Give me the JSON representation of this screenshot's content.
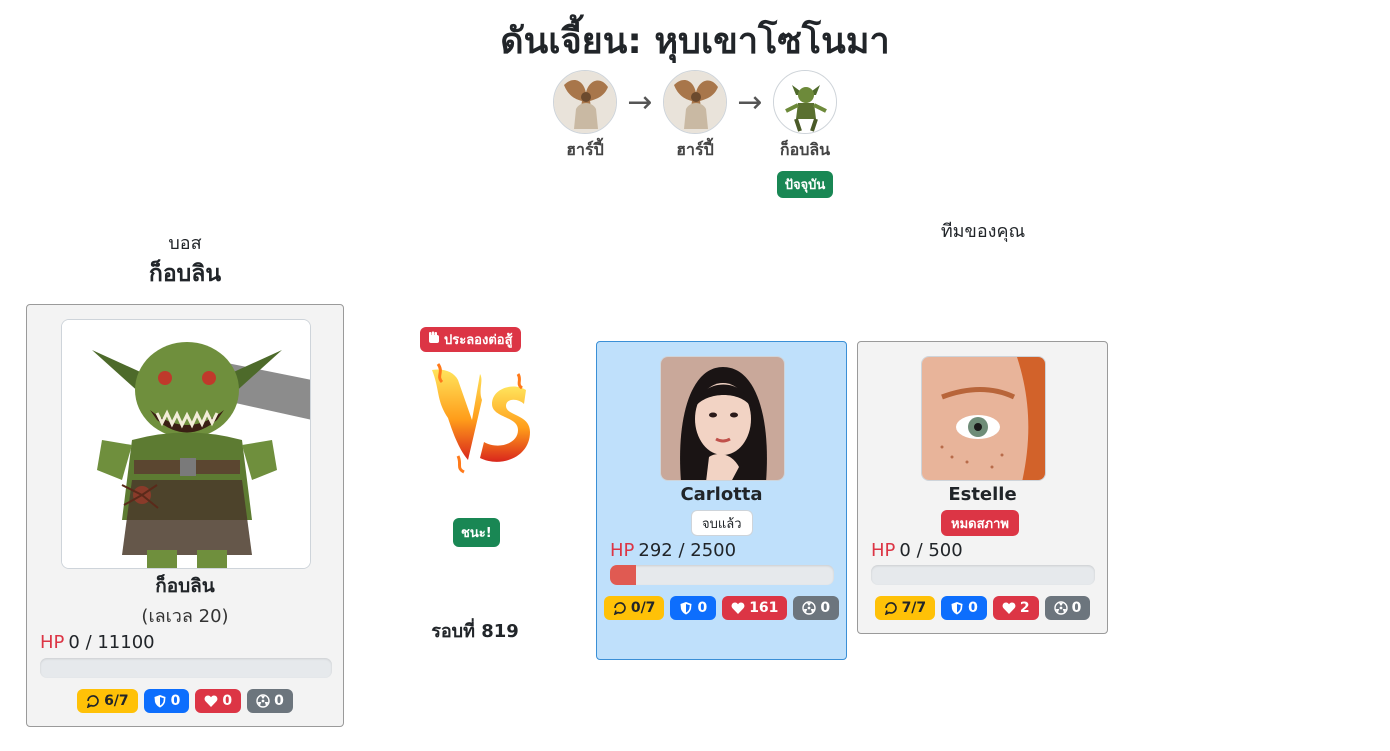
{
  "dungeon_title": "ดันเจี้ยน: หุบเขาโซโนมา",
  "stages": [
    {
      "name": "ฮาร์ปี้",
      "icon": "harpy-icon"
    },
    {
      "name": "ฮาร์ปี้",
      "icon": "harpy-icon"
    },
    {
      "name": "ก็อบลิน",
      "icon": "goblin-icon",
      "badge": "ปัจจุบัน"
    }
  ],
  "boss": {
    "section_label": "บอส",
    "header_name": "ก็อบลิน",
    "name": "ก็อบลิน",
    "level": "(เลเวล 20)",
    "hp_label": "HP",
    "hp_text": "0 / 11100",
    "hp_fraction": 0,
    "stats": {
      "charge": "6/7",
      "shield": "0",
      "heal": "0",
      "poison": "0"
    }
  },
  "battle": {
    "fight_label": "ประลองต่อสู้",
    "result": "ชนะ!",
    "round": "รอบที่ 819"
  },
  "team": {
    "section_label": "ทีมของคุณ",
    "members": [
      {
        "name": "Carlotta",
        "status": "จบแล้ว",
        "hp_label": "HP",
        "hp_text": "292 / 2500",
        "hp_fraction": 0.1168,
        "stats": {
          "charge": "0/7",
          "shield": "0",
          "heal": "161",
          "poison": "0"
        }
      },
      {
        "name": "Estelle",
        "status": "หมดสภาพ",
        "hp_label": "HP",
        "hp_text": "0 / 500",
        "hp_fraction": 0,
        "stats": {
          "charge": "7/7",
          "shield": "0",
          "heal": "2",
          "poison": "0"
        }
      }
    ]
  },
  "colors": {
    "success": "#198754",
    "danger": "#dc3545",
    "primary": "#0d6efd",
    "warning": "#ffc107",
    "secondary": "#6c757d"
  }
}
